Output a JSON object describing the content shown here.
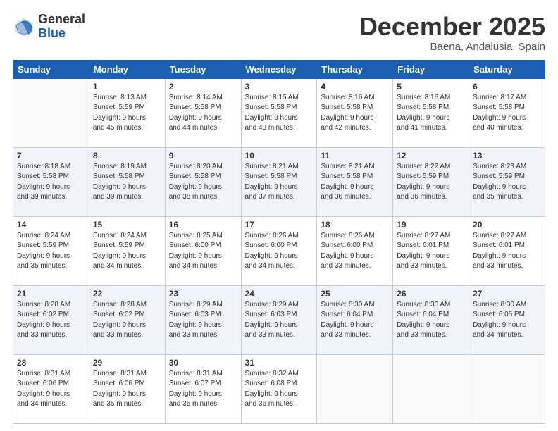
{
  "header": {
    "logo_general": "General",
    "logo_blue": "Blue",
    "month_title": "December 2025",
    "subtitle": "Baena, Andalusia, Spain"
  },
  "weekdays": [
    "Sunday",
    "Monday",
    "Tuesday",
    "Wednesday",
    "Thursday",
    "Friday",
    "Saturday"
  ],
  "weeks": [
    [
      {
        "day": "",
        "content": ""
      },
      {
        "day": "1",
        "content": "Sunrise: 8:13 AM\nSunset: 5:59 PM\nDaylight: 9 hours\nand 45 minutes."
      },
      {
        "day": "2",
        "content": "Sunrise: 8:14 AM\nSunset: 5:58 PM\nDaylight: 9 hours\nand 44 minutes."
      },
      {
        "day": "3",
        "content": "Sunrise: 8:15 AM\nSunset: 5:58 PM\nDaylight: 9 hours\nand 43 minutes."
      },
      {
        "day": "4",
        "content": "Sunrise: 8:16 AM\nSunset: 5:58 PM\nDaylight: 9 hours\nand 42 minutes."
      },
      {
        "day": "5",
        "content": "Sunrise: 8:16 AM\nSunset: 5:58 PM\nDaylight: 9 hours\nand 41 minutes."
      },
      {
        "day": "6",
        "content": "Sunrise: 8:17 AM\nSunset: 5:58 PM\nDaylight: 9 hours\nand 40 minutes."
      }
    ],
    [
      {
        "day": "7",
        "content": "Sunrise: 8:18 AM\nSunset: 5:58 PM\nDaylight: 9 hours\nand 39 minutes."
      },
      {
        "day": "8",
        "content": "Sunrise: 8:19 AM\nSunset: 5:58 PM\nDaylight: 9 hours\nand 39 minutes."
      },
      {
        "day": "9",
        "content": "Sunrise: 8:20 AM\nSunset: 5:58 PM\nDaylight: 9 hours\nand 38 minutes."
      },
      {
        "day": "10",
        "content": "Sunrise: 8:21 AM\nSunset: 5:58 PM\nDaylight: 9 hours\nand 37 minutes."
      },
      {
        "day": "11",
        "content": "Sunrise: 8:21 AM\nSunset: 5:58 PM\nDaylight: 9 hours\nand 36 minutes."
      },
      {
        "day": "12",
        "content": "Sunrise: 8:22 AM\nSunset: 5:59 PM\nDaylight: 9 hours\nand 36 minutes."
      },
      {
        "day": "13",
        "content": "Sunrise: 8:23 AM\nSunset: 5:59 PM\nDaylight: 9 hours\nand 35 minutes."
      }
    ],
    [
      {
        "day": "14",
        "content": "Sunrise: 8:24 AM\nSunset: 5:59 PM\nDaylight: 9 hours\nand 35 minutes."
      },
      {
        "day": "15",
        "content": "Sunrise: 8:24 AM\nSunset: 5:59 PM\nDaylight: 9 hours\nand 34 minutes."
      },
      {
        "day": "16",
        "content": "Sunrise: 8:25 AM\nSunset: 6:00 PM\nDaylight: 9 hours\nand 34 minutes."
      },
      {
        "day": "17",
        "content": "Sunrise: 8:26 AM\nSunset: 6:00 PM\nDaylight: 9 hours\nand 34 minutes."
      },
      {
        "day": "18",
        "content": "Sunrise: 8:26 AM\nSunset: 6:00 PM\nDaylight: 9 hours\nand 33 minutes."
      },
      {
        "day": "19",
        "content": "Sunrise: 8:27 AM\nSunset: 6:01 PM\nDaylight: 9 hours\nand 33 minutes."
      },
      {
        "day": "20",
        "content": "Sunrise: 8:27 AM\nSunset: 6:01 PM\nDaylight: 9 hours\nand 33 minutes."
      }
    ],
    [
      {
        "day": "21",
        "content": "Sunrise: 8:28 AM\nSunset: 6:02 PM\nDaylight: 9 hours\nand 33 minutes."
      },
      {
        "day": "22",
        "content": "Sunrise: 8:28 AM\nSunset: 6:02 PM\nDaylight: 9 hours\nand 33 minutes."
      },
      {
        "day": "23",
        "content": "Sunrise: 8:29 AM\nSunset: 6:03 PM\nDaylight: 9 hours\nand 33 minutes."
      },
      {
        "day": "24",
        "content": "Sunrise: 8:29 AM\nSunset: 6:03 PM\nDaylight: 9 hours\nand 33 minutes."
      },
      {
        "day": "25",
        "content": "Sunrise: 8:30 AM\nSunset: 6:04 PM\nDaylight: 9 hours\nand 33 minutes."
      },
      {
        "day": "26",
        "content": "Sunrise: 8:30 AM\nSunset: 6:04 PM\nDaylight: 9 hours\nand 33 minutes."
      },
      {
        "day": "27",
        "content": "Sunrise: 8:30 AM\nSunset: 6:05 PM\nDaylight: 9 hours\nand 34 minutes."
      }
    ],
    [
      {
        "day": "28",
        "content": "Sunrise: 8:31 AM\nSunset: 6:06 PM\nDaylight: 9 hours\nand 34 minutes."
      },
      {
        "day": "29",
        "content": "Sunrise: 8:31 AM\nSunset: 6:06 PM\nDaylight: 9 hours\nand 35 minutes."
      },
      {
        "day": "30",
        "content": "Sunrise: 8:31 AM\nSunset: 6:07 PM\nDaylight: 9 hours\nand 35 minutes."
      },
      {
        "day": "31",
        "content": "Sunrise: 8:32 AM\nSunset: 6:08 PM\nDaylight: 9 hours\nand 36 minutes."
      },
      {
        "day": "",
        "content": ""
      },
      {
        "day": "",
        "content": ""
      },
      {
        "day": "",
        "content": ""
      }
    ]
  ]
}
